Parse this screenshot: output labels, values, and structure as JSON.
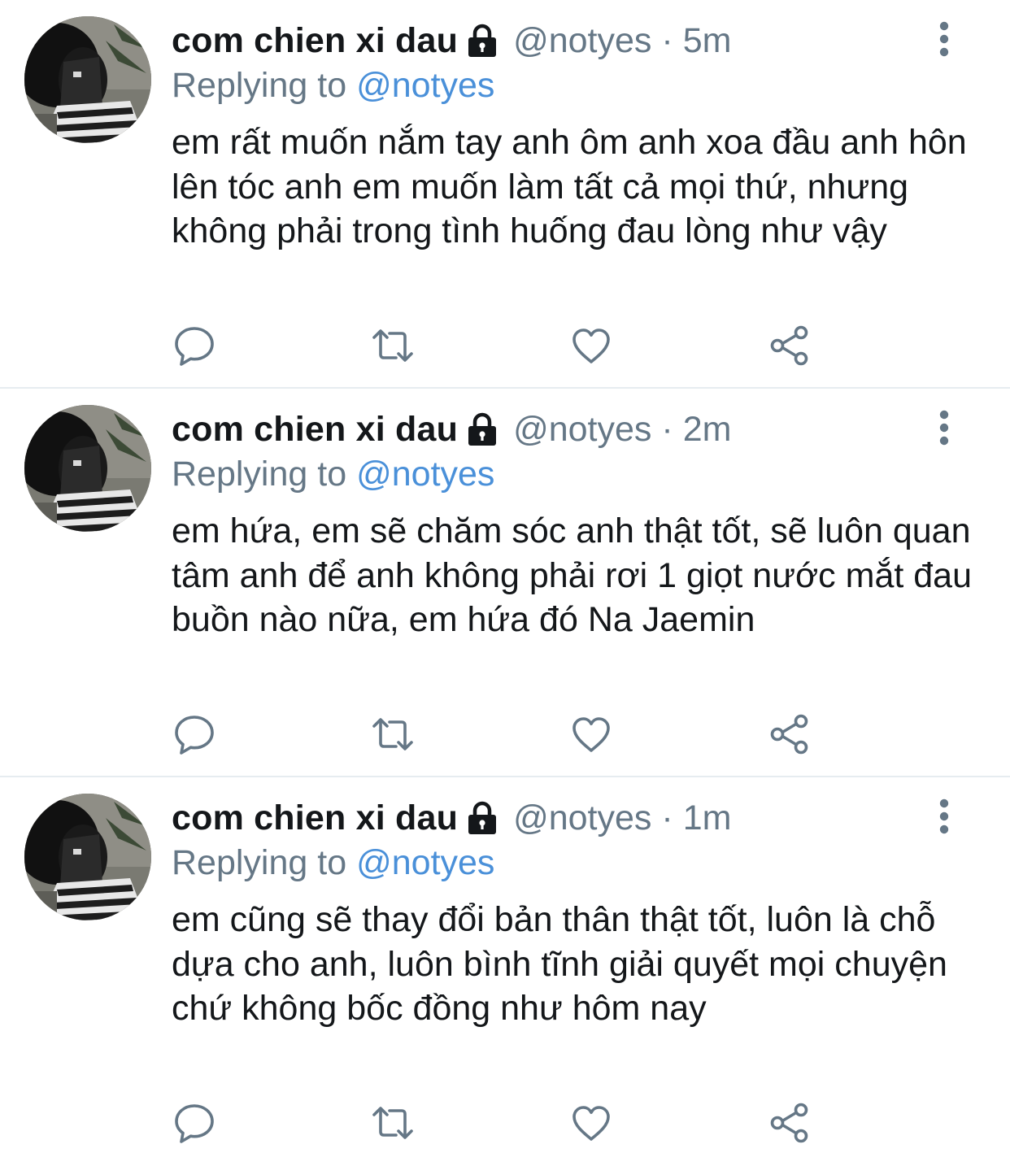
{
  "tweets": [
    {
      "name": "com chien xi dau",
      "handle": "@notyes",
      "separator": "·",
      "time": "5m",
      "replying_prefix": "Replying to",
      "replying_to": "@notyes",
      "text": "em rất muốn nắm tay anh ôm anh xoa đầu anh hôn lên tóc anh em muốn làm tất cả mọi thứ, nhưng không phải trong tình huống đau lòng như vậy"
    },
    {
      "name": "com chien xi dau",
      "handle": "@notyes",
      "separator": "·",
      "time": "2m",
      "replying_prefix": "Replying to",
      "replying_to": "@notyes",
      "text": "em hứa, em sẽ chăm sóc anh thật tốt, sẽ luôn quan tâm anh để anh không phải rơi 1 giọt nước mắt đau buồn nào nữa, em hứa đó Na Jaemin"
    },
    {
      "name": "com chien xi dau",
      "handle": "@notyes",
      "separator": "·",
      "time": "1m",
      "replying_prefix": "Replying to",
      "replying_to": "@notyes",
      "text": "em cũng sẽ thay đổi bản thân thật tốt, luôn là chỗ dựa cho anh, luôn bình tĩnh giải quyết mọi chuyện chứ không bốc đồng như hôm nay"
    }
  ],
  "icons": {
    "lock": "lock-icon",
    "more": "more-vertical-icon",
    "reply": "reply-icon",
    "retweet": "retweet-icon",
    "like": "heart-icon",
    "share": "share-icon"
  },
  "colors": {
    "text": "#14171a",
    "secondary": "#657786",
    "link": "#4a90d9",
    "icon": "#657786",
    "divider": "#e6ecf0"
  }
}
